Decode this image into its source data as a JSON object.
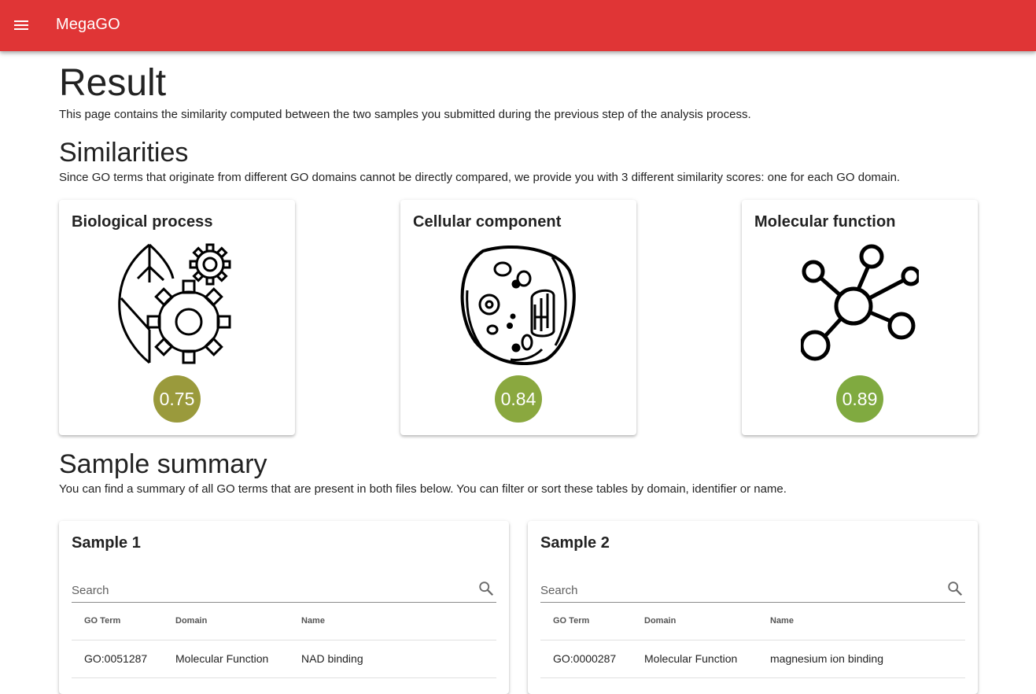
{
  "app": {
    "title": "MegaGO",
    "menu_icon": "menu-icon",
    "bar_color": "#e03536"
  },
  "result": {
    "title": "Result",
    "description": "This page contains the similarity computed between the two samples you submitted during the previous step of the analysis process."
  },
  "similarities": {
    "title": "Similarities",
    "description": "Since GO terms that originate from different GO domains cannot be directly compared, we provide you with 3 different similarity scores: one for each GO domain.",
    "cards": [
      {
        "title": "Biological process",
        "icon": "biological-process-icon",
        "score": "0.75",
        "color": "#9a9a3c"
      },
      {
        "title": "Cellular component",
        "icon": "cell-icon",
        "score": "0.84",
        "color": "#8aa83f"
      },
      {
        "title": "Molecular function",
        "icon": "molecule-icon",
        "score": "0.89",
        "color": "#80aa40"
      }
    ]
  },
  "summary": {
    "title": "Sample summary",
    "description": "You can find a summary of all GO terms that are present in both files below. You can filter or sort these tables by domain, identifier or name.",
    "samples": [
      {
        "title": "Sample 1",
        "search_placeholder": "Search",
        "columns": [
          "GO Term",
          "Domain",
          "Name"
        ],
        "rows": [
          [
            "GO:0051287",
            "Molecular Function",
            "NAD binding"
          ]
        ]
      },
      {
        "title": "Sample 2",
        "search_placeholder": "Search",
        "columns": [
          "GO Term",
          "Domain",
          "Name"
        ],
        "rows": [
          [
            "GO:0000287",
            "Molecular Function",
            "magnesium ion binding"
          ]
        ]
      }
    ]
  }
}
